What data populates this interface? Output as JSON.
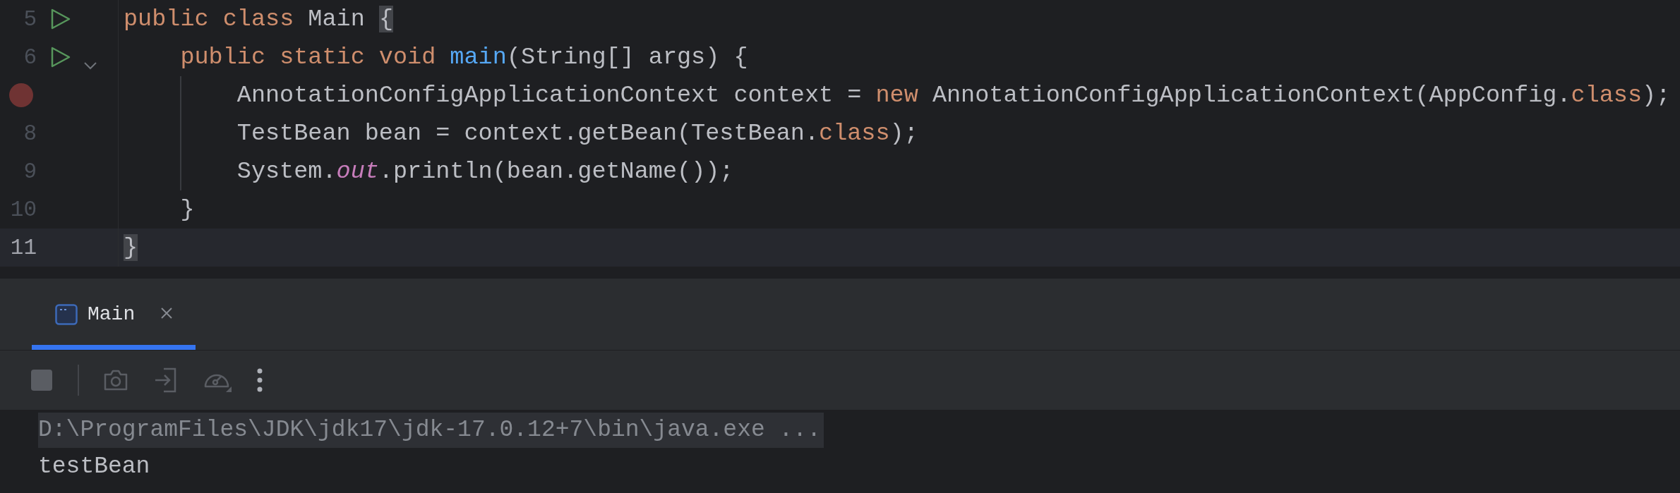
{
  "editor": {
    "lines": [
      {
        "number": "5",
        "run_marker": true,
        "breakpoint": false,
        "foldable": false,
        "current": false,
        "tokens": [
          {
            "kind": "keyword",
            "text": "public class"
          },
          {
            "kind": "plain",
            "text": " Main "
          },
          {
            "kind": "brace",
            "text": "{"
          }
        ],
        "children": [
          {
            "number": "6",
            "run_marker": true,
            "breakpoint": false,
            "foldable": true,
            "current": false,
            "tokens": [
              {
                "kind": "keyword",
                "text": "public static void"
              },
              {
                "kind": "method",
                "text": "main",
                "space_before": true
              },
              {
                "kind": "plain",
                "text": "(String[] args) {"
              }
            ],
            "children": [
              {
                "run_marker": false,
                "breakpoint": true,
                "foldable": false,
                "current": false,
                "tokens": [
                  {
                    "kind": "plain",
                    "text": "AnnotationConfigApplicationContext context = "
                  },
                  {
                    "kind": "keyword",
                    "text": "new"
                  },
                  {
                    "kind": "plain",
                    "text": " AnnotationConfigApplicationContext(AppConfig."
                  },
                  {
                    "kind": "keyword",
                    "text": "class"
                  },
                  {
                    "kind": "plain",
                    "text": ");"
                  }
                ]
              },
              {
                "number": "8",
                "run_marker": false,
                "breakpoint": false,
                "foldable": false,
                "current": false,
                "tokens": [
                  {
                    "kind": "plain",
                    "text": "TestBean bean = context.getBean(TestBean."
                  },
                  {
                    "kind": "keyword",
                    "text": "class"
                  },
                  {
                    "kind": "plain",
                    "text": ");"
                  }
                ]
              },
              {
                "number": "9",
                "run_marker": false,
                "breakpoint": false,
                "foldable": false,
                "current": false,
                "tokens": [
                  {
                    "kind": "plain",
                    "text": "System."
                  },
                  {
                    "kind": "field",
                    "text": "out"
                  },
                  {
                    "kind": "plain",
                    "text": ".println(bean.getName());"
                  }
                ]
              }
            ]
          },
          {
            "number": "10",
            "run_marker": false,
            "breakpoint": false,
            "foldable": false,
            "current": false,
            "tokens": [
              {
                "kind": "plain",
                "text": "}"
              }
            ]
          }
        ]
      },
      {
        "number": "11",
        "run_marker": false,
        "breakpoint": false,
        "foldable": false,
        "current": true,
        "tokens": [
          {
            "kind": "brace",
            "text": "}"
          }
        ]
      }
    ]
  },
  "run_panel": {
    "tabs": [
      {
        "label": "Main",
        "selected": true
      }
    ],
    "toolbar": [
      {
        "kind": "stop"
      },
      {
        "kind": "camera"
      },
      {
        "kind": "login"
      },
      {
        "kind": "gauge"
      },
      {
        "kind": "more"
      }
    ],
    "console": [
      {
        "kind": "command",
        "text": "D:\\ProgramFiles\\JDK\\jdk17\\jdk-17.0.12+7\\bin\\java.exe ..."
      },
      {
        "kind": "output",
        "text": "testBean"
      }
    ]
  }
}
